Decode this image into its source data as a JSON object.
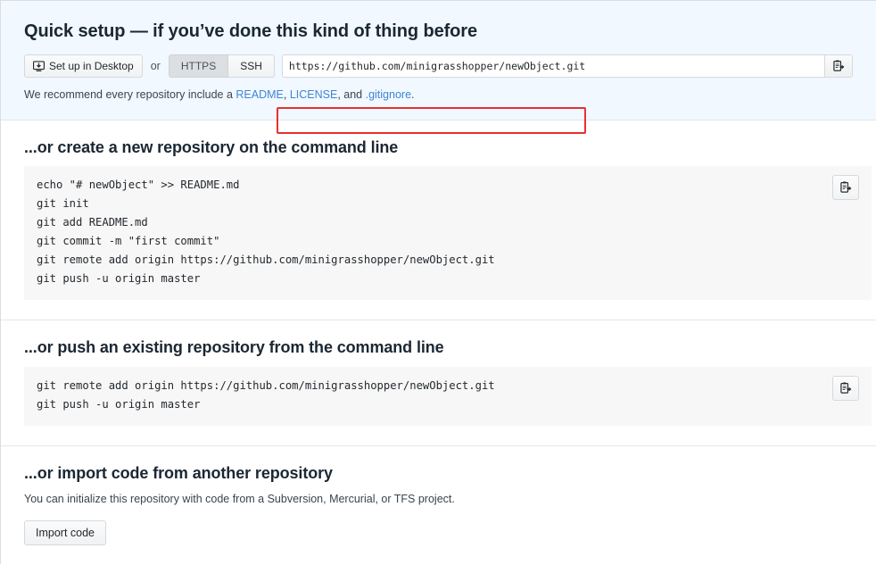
{
  "quick_setup": {
    "title": "Quick setup — if you’ve done this kind of thing before",
    "desktop_button": "Set up in Desktop",
    "desktop_icon": "desktop-download-icon",
    "or_label": "or",
    "protocols": [
      {
        "label": "HTTPS",
        "selected": true
      },
      {
        "label": "SSH",
        "selected": false
      }
    ],
    "url_value": "https://github.com/minigrasshopper/newObject.git",
    "copy_icon": "clipboard-copy-icon",
    "highlight_color": "#e8302f",
    "recommend": {
      "prefix": "We recommend every repository include a ",
      "link_readme": "README",
      "sep1": ", ",
      "link_license": "LICENSE",
      "sep2": ", and ",
      "link_gitignore": ".gitignore",
      "suffix": ".",
      "link_color": "#3f86d4"
    }
  },
  "create_section": {
    "title": "...or create a new repository on the command line",
    "copy_icon": "clipboard-copy-icon",
    "lines": [
      "echo \"# newObject\" >> README.md",
      "git init",
      "git add README.md",
      "git commit -m \"first commit\"",
      "git remote add origin https://github.com/minigrasshopper/newObject.git",
      "git push -u origin master"
    ]
  },
  "push_section": {
    "title": "...or push an existing repository from the command line",
    "copy_icon": "clipboard-copy-icon",
    "lines": [
      "git remote add origin https://github.com/minigrasshopper/newObject.git",
      "git push -u origin master"
    ]
  },
  "import_section": {
    "title": "...or import code from another repository",
    "description": "You can initialize this repository with code from a Subversion, Mercurial, or TFS project.",
    "button_label": "Import code"
  }
}
